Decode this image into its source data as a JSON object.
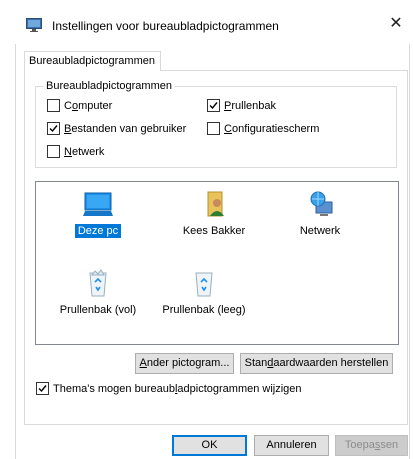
{
  "window": {
    "title": "Instellingen voor bureaubladpictogrammen",
    "close_glyph": "✕",
    "app_icon": "desktop-settings-icon"
  },
  "tabs": [
    {
      "label": "Bureaubladpictogrammen",
      "active": true
    }
  ],
  "group": {
    "legend": "Bureaubladpictogrammen",
    "checkboxes": [
      {
        "key": "computer",
        "pre": "",
        "accel": "o",
        "post": "",
        "label_full": "Computer",
        "checked": false
      },
      {
        "key": "prullenbak",
        "label_full": "Prullenbak",
        "checked": true
      },
      {
        "key": "bestanden",
        "label_full": "Bestanden van gebruiker",
        "checked": true
      },
      {
        "key": "configuratiescherm",
        "label_full": "Configuratiescherm",
        "checked": false
      },
      {
        "key": "netwerk",
        "label_full": "Netwerk",
        "checked": false
      }
    ]
  },
  "icons": [
    {
      "label": "Deze pc",
      "icon": "computer-monitor-icon",
      "selected": true
    },
    {
      "label": "Kees Bakker",
      "icon": "user-folder-icon",
      "selected": false
    },
    {
      "label": "Netwerk",
      "icon": "network-globe-icon",
      "selected": false
    },
    {
      "label": "Prullenbak (vol)",
      "icon": "recycle-bin-full-icon",
      "selected": false
    },
    {
      "label": "Prullenbak (leeg)",
      "icon": "recycle-bin-empty-icon",
      "selected": false
    }
  ],
  "buttons": {
    "change_icon": "Ander pictogram...",
    "restore_default": "Standaardwaarden herstellen",
    "ok": "OK",
    "cancel": "Annuleren",
    "apply": "Toepassen"
  },
  "themes_checkbox": {
    "label": "Thema's mogen bureaubladpictogrammen wijzigen",
    "checked": true
  },
  "colors": {
    "accent": "#0078d7",
    "button_face": "#e1e1e1",
    "border": "#adadad"
  }
}
